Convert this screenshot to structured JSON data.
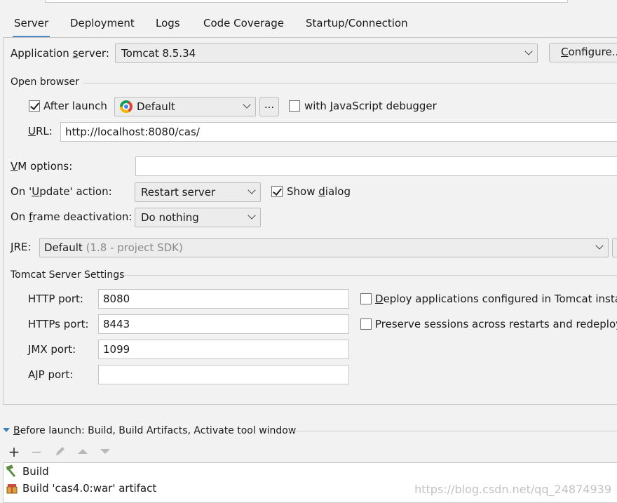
{
  "tabs": [
    {
      "label": "Server",
      "active": true
    },
    {
      "label": "Deployment"
    },
    {
      "label": "Logs"
    },
    {
      "label": "Code Coverage"
    },
    {
      "label": "Startup/Connection"
    }
  ],
  "server": {
    "app_server_label_pre": "Application ",
    "app_server_label_mn": "s",
    "app_server_label_post": "erver:",
    "app_server_value": "Tomcat 8.5.34",
    "configure_mn": "C",
    "configure_rest": "onfigure..."
  },
  "open_browser": {
    "section_title": "Open browser",
    "after_launch_label": "After launch",
    "after_launch_checked": true,
    "browser_value": "Default",
    "browse_button": "...",
    "js_debugger_pre": "with ",
    "js_debugger_mn": "J",
    "js_debugger_post": "avaScript debugger",
    "js_debugger_checked": false,
    "url_label_mn": "U",
    "url_label_rest": "RL:",
    "url_value": "http://localhost:8080/cas/"
  },
  "vm": {
    "label_mn": "V",
    "label_rest": "M options:",
    "value": ""
  },
  "update_action": {
    "label_pre": "On '",
    "label_mn": "U",
    "label_post": "pdate' action:",
    "value": "Restart server",
    "show_dialog_pre": "Show ",
    "show_dialog_mn": "d",
    "show_dialog_post": "ialog",
    "show_dialog_checked": true
  },
  "frame_deactivation": {
    "label_pre": "On ",
    "label_mn": "f",
    "label_post": "rame deactivation:",
    "value": "Do nothing"
  },
  "jre": {
    "label_mn": "J",
    "label_rest": "RE:",
    "value": "Default",
    "hint": "(1.8 - project SDK)"
  },
  "tomcat": {
    "section_title": "Tomcat Server Settings",
    "http_label": "HTTP port:",
    "http_value": "8080",
    "https_label": "HTTPs port:",
    "https_value": "8443",
    "jmx_label": "JMX port:",
    "jmx_value": "1099",
    "ajp_label": "AJP port:",
    "ajp_value": "",
    "deploy_mn": "D",
    "deploy_rest": "eploy applications configured in Tomcat instar",
    "deploy_checked": false,
    "preserve_label": "Preserve sessions across restarts and redeploys",
    "preserve_checked": false
  },
  "before_launch": {
    "title_mn": "B",
    "title_rest": "efore launch: Build, Build Artifacts, Activate tool window",
    "toolbar": [
      "add-icon",
      "remove-icon",
      "edit-icon",
      "move-up-icon",
      "move-down-icon"
    ],
    "items": [
      {
        "label": "Build",
        "icon": "hammer-icon"
      },
      {
        "label": "Build 'cas4.0:war' artifact",
        "icon": "artifact-icon"
      }
    ]
  },
  "watermark": "https://blog.csdn.net/qq_24874939",
  "colors": {
    "accent": "#4a88c7",
    "background": "#f2f2f2"
  }
}
